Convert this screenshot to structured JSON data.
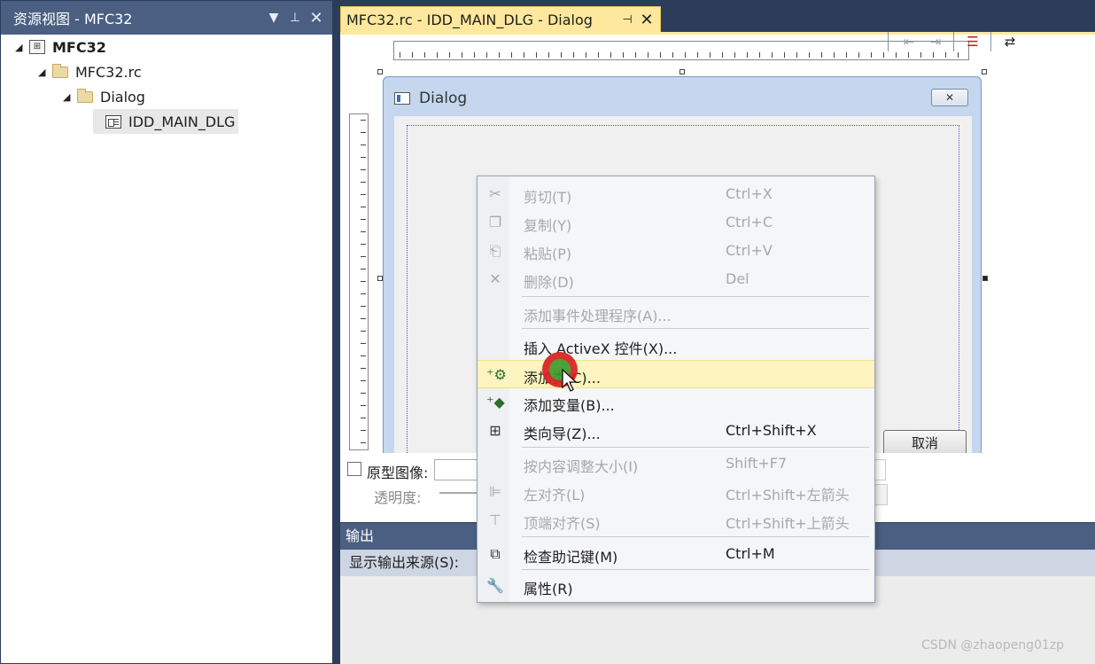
{
  "left_panel": {
    "title": "资源视图 - MFC32",
    "tree": [
      {
        "label": "MFC32",
        "icon": "project-icon",
        "bold": true
      },
      {
        "label": "MFC32.rc",
        "icon": "folder-icon"
      },
      {
        "label": "Dialog",
        "icon": "folder-icon"
      },
      {
        "label": "IDD_MAIN_DLG",
        "icon": "dialog-resource-icon"
      }
    ]
  },
  "editor": {
    "tab_label": "MFC32.rc - IDD_MAIN_DLG - Dialog",
    "dialog_title": "Dialog",
    "cancel_label": "取消"
  },
  "props": {
    "prototype_label": "原型图像:",
    "opacity_label": "透明度:"
  },
  "output": {
    "title": "输出",
    "source_label": "显示输出来源(S):"
  },
  "context_menu": {
    "items": [
      {
        "label": "剪切(T)",
        "shortcut": "Ctrl+X",
        "icon": "scissors-icon",
        "disabled": true
      },
      {
        "label": "复制(Y)",
        "shortcut": "Ctrl+C",
        "icon": "copy-icon",
        "disabled": true
      },
      {
        "label": "粘贴(P)",
        "shortcut": "Ctrl+V",
        "icon": "paste-icon",
        "disabled": true
      },
      {
        "label": "删除(D)",
        "shortcut": "Del",
        "icon": "delete-icon",
        "disabled": true
      },
      {
        "label": "添加事件处理程序(A)...",
        "shortcut": "",
        "icon": "",
        "disabled": true
      },
      {
        "label": "插入 ActiveX 控件(X)...",
        "shortcut": "",
        "icon": "",
        "disabled": false
      },
      {
        "label": "添加类(C)...",
        "shortcut": "",
        "icon": "add-class-icon",
        "disabled": false,
        "highlighted": true
      },
      {
        "label": "添加变量(B)...",
        "shortcut": "",
        "icon": "add-variable-icon",
        "disabled": false
      },
      {
        "label": "类向导(Z)...",
        "shortcut": "Ctrl+Shift+X",
        "icon": "class-wizard-icon",
        "disabled": false
      },
      {
        "label": "按内容调整大小(I)",
        "shortcut": "Shift+F7",
        "icon": "",
        "disabled": true
      },
      {
        "label": "左对齐(L)",
        "shortcut": "Ctrl+Shift+左箭头",
        "icon": "align-left-icon",
        "disabled": true
      },
      {
        "label": "顶端对齐(S)",
        "shortcut": "Ctrl+Shift+上箭头",
        "icon": "align-top-icon",
        "disabled": true
      },
      {
        "label": "检查助记键(M)",
        "shortcut": "Ctrl+M",
        "icon": "check-mnemonics-icon",
        "disabled": false
      },
      {
        "label": "属性(R)",
        "shortcut": "",
        "icon": "wrench-icon",
        "disabled": false
      }
    ]
  },
  "watermark": "CSDN @zhaopeng01zp"
}
